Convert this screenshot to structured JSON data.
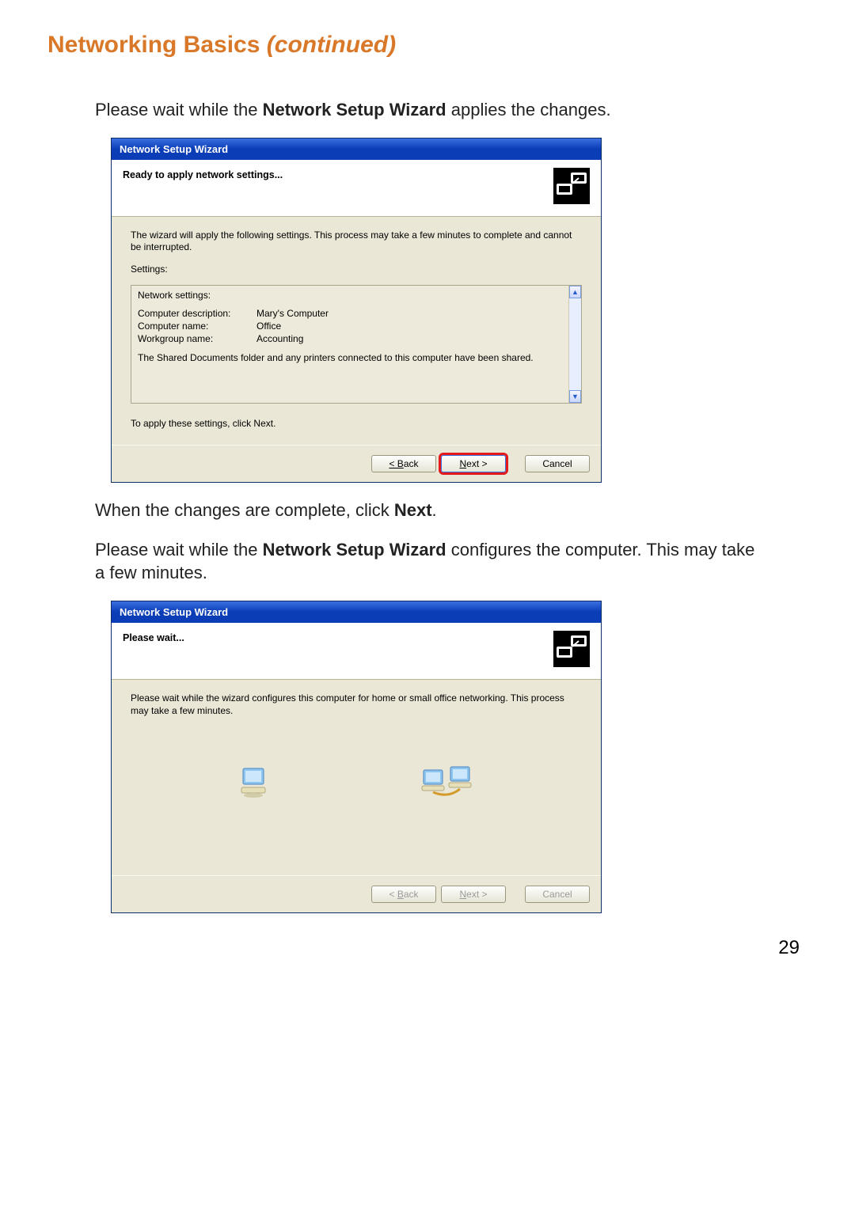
{
  "page": {
    "title_main": "Networking Basics ",
    "title_cont": "(continued)",
    "number": "29"
  },
  "para1_pre": "Please wait while the ",
  "para1_bold": "Network Setup Wizard",
  "para1_post": " applies the changes.",
  "para2_pre": "When the changes are complete, click ",
  "para2_bold": "Next",
  "para2_post": ".",
  "para3_pre": "Please wait while the ",
  "para3_bold": "Network Setup Wizard",
  "para3_post": " configures the computer. This may take a few minutes.",
  "wizard1": {
    "title": "Network Setup Wizard",
    "heading": "Ready to apply network settings...",
    "intro": "The wizard will apply the following settings. This process may take a few minutes to complete and cannot be interrupted.",
    "settings_label": "Settings:",
    "panel": {
      "header": "Network settings:",
      "rows": [
        {
          "k": "Computer description:",
          "v": "Mary's Computer"
        },
        {
          "k": "Computer name:",
          "v": "Office"
        },
        {
          "k": "Workgroup name:",
          "v": "Accounting"
        }
      ],
      "footer": "The Shared Documents folder and any printers connected to this computer have been shared."
    },
    "instruction": "To apply these settings, click Next.",
    "buttons": {
      "back": "< Back",
      "next": "Next >",
      "cancel": "Cancel"
    }
  },
  "wizard2": {
    "title": "Network Setup Wizard",
    "heading": "Please wait...",
    "intro": "Please wait while the wizard configures this computer for home or small office networking. This process may take a few minutes.",
    "buttons": {
      "back": "< Back",
      "next": "Next >",
      "cancel": "Cancel"
    }
  }
}
